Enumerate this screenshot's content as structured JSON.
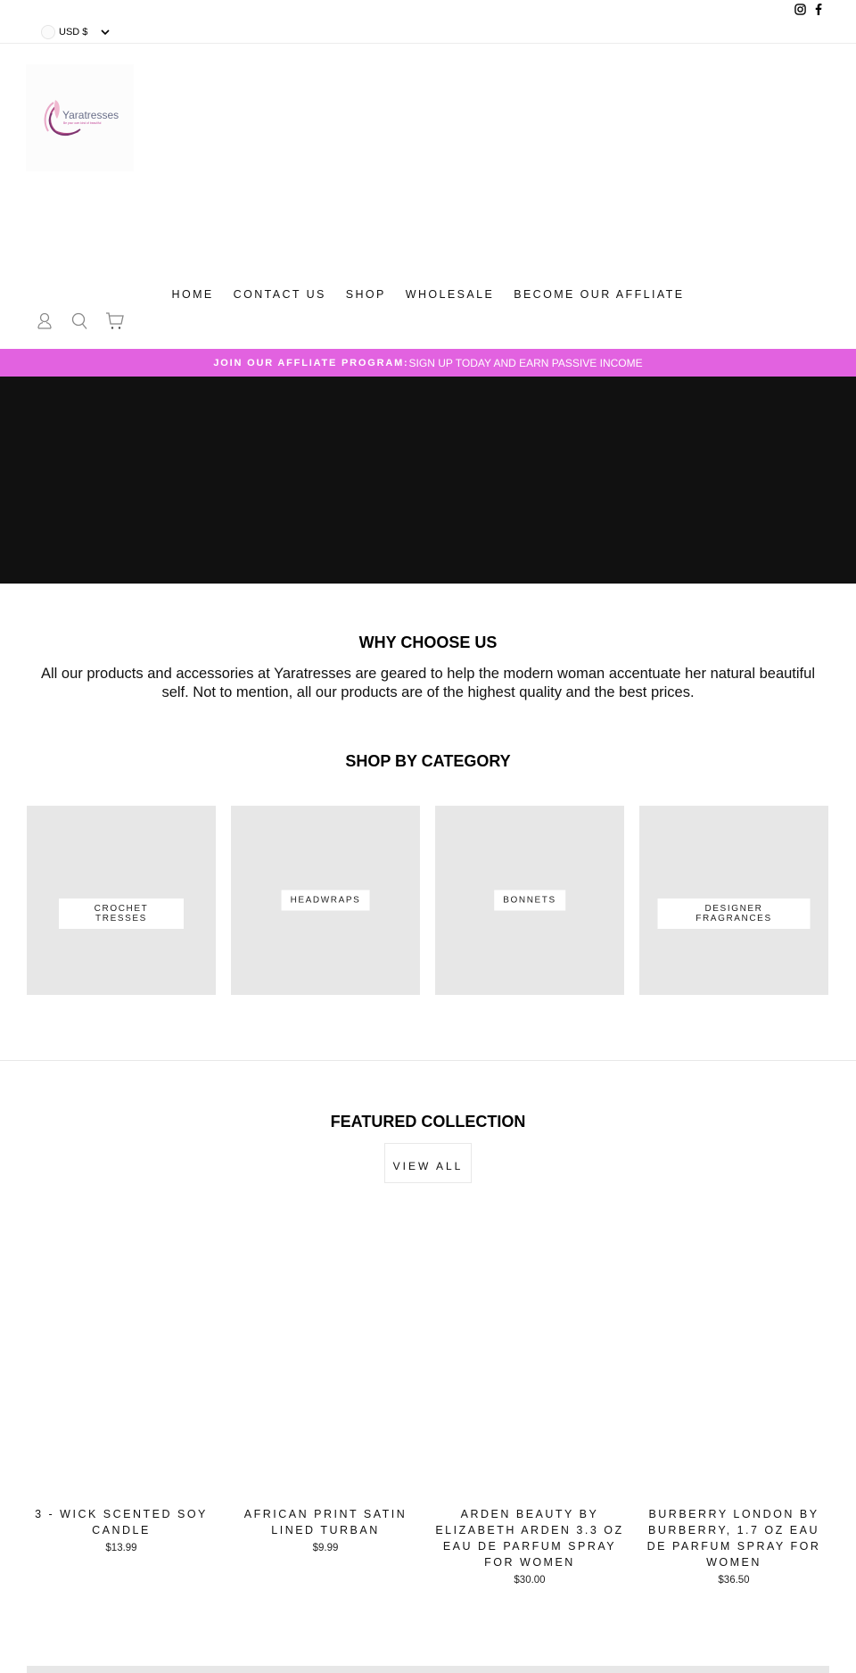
{
  "header": {
    "currency": "USD $",
    "social": [
      "instagram-icon",
      "facebook-icon"
    ],
    "logo": {
      "brand": "Yaratresses",
      "tagline": "Be your own kind of beautiful"
    },
    "nav": [
      "HOME",
      "CONTACT US",
      "SHOP",
      "WHOLESALE",
      "BECOME OUR AFFLIATE"
    ],
    "icons": [
      "account-icon",
      "search-icon",
      "cart-icon"
    ]
  },
  "announcement": {
    "bold": "JOIN OUR AFFLIATE PROGRAM:",
    "text": "SIGN UP TODAY AND EARN PASSIVE INCOME",
    "color": "#e262e0"
  },
  "hero": {
    "color": "#111111"
  },
  "why": {
    "title": "WHY CHOOSE US",
    "text": "All our products and accessories at Yaratresses are geared to help the modern woman accentuate her natural beautiful self.  Not to mention, all our products are of the highest quality and the best prices."
  },
  "categories": {
    "title": "SHOP BY CATEGORY",
    "items": [
      {
        "label": "CROCHET TRESSES"
      },
      {
        "label": "HEADWRAPS"
      },
      {
        "label": "BONNETS"
      },
      {
        "label": "DESIGNER FRAGRANCES"
      }
    ]
  },
  "featured": {
    "title": "FEATURED COLLECTION",
    "view_all": "VIEW ALL",
    "products": [
      {
        "name": "3 - WICK SCENTED SOY CANDLE",
        "price": "$13.99"
      },
      {
        "name": "AFRICAN PRINT SATIN LINED TURBAN",
        "price": "$9.99"
      },
      {
        "name": "ARDEN BEAUTY BY ELIZABETH ARDEN 3.3 OZ EAU DE PARFUM SPRAY FOR WOMEN",
        "price": "$30.00"
      },
      {
        "name": "BURBERRY LONDON BY BURBERRY, 1.7 OZ EAU DE PARFUM SPRAY FOR WOMEN",
        "price": "$36.50"
      }
    ]
  }
}
